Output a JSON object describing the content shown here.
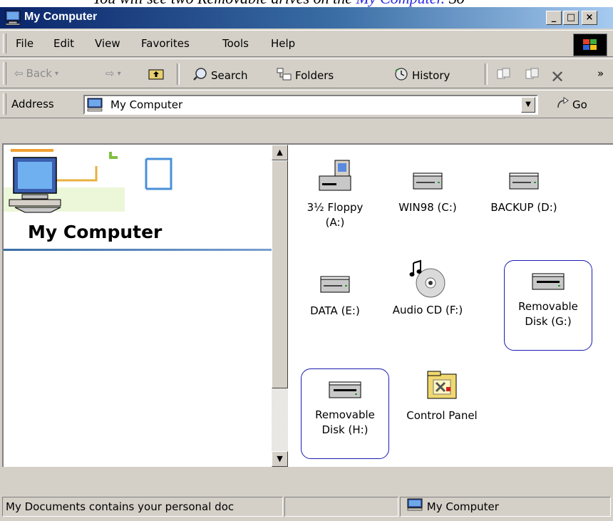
{
  "caption": {
    "text": "You will see two Removable drives on the ",
    "link": "My Computer.",
    "tail": " So"
  },
  "window": {
    "title": "My Computer",
    "min": "_",
    "max": "□",
    "close": "×"
  },
  "menu": [
    "File",
    "Edit",
    "View",
    "Favorites",
    "Tools",
    "Help"
  ],
  "toolbar": {
    "back": "Back",
    "search": "Search",
    "folders": "Folders",
    "history": "History",
    "more": "»"
  },
  "address": {
    "label": "Address",
    "value": "My Computer",
    "go": "Go"
  },
  "left_pane": {
    "title": "My Computer"
  },
  "items": [
    {
      "name": "3½ Floppy (A:)",
      "line1": "3½ Floppy",
      "line2": "(A:)",
      "icon": "floppy-drive-icon"
    },
    {
      "name": "WIN98 (C:)",
      "line1": "WIN98 (C:)",
      "line2": "",
      "icon": "hard-drive-icon"
    },
    {
      "name": "BACKUP (D:)",
      "line1": "BACKUP (D:)",
      "line2": "",
      "icon": "hard-drive-icon"
    },
    {
      "name": "DATA (E:)",
      "line1": "DATA (E:)",
      "line2": "",
      "icon": "hard-drive-icon"
    },
    {
      "name": "Audio CD (F:)",
      "line1": "Audio CD (F:)",
      "line2": "",
      "icon": "audio-cd-icon"
    },
    {
      "name": "Removable Disk (G:)",
      "line1": "Removable",
      "line2": "Disk (G:)",
      "icon": "removable-disk-icon"
    },
    {
      "name": "Removable Disk (H:)",
      "line1": "Removable",
      "line2": "Disk (H:)",
      "icon": "removable-disk-icon"
    },
    {
      "name": "Control Panel",
      "line1": "Control Panel",
      "line2": "",
      "icon": "control-panel-icon"
    }
  ],
  "status": {
    "left": "My Documents contains your personal doc",
    "right": "My Computer"
  },
  "colors": {
    "title_bar": "#0a246a",
    "selection_outline": "#1a1ab0",
    "face": "#d4d0c8"
  }
}
